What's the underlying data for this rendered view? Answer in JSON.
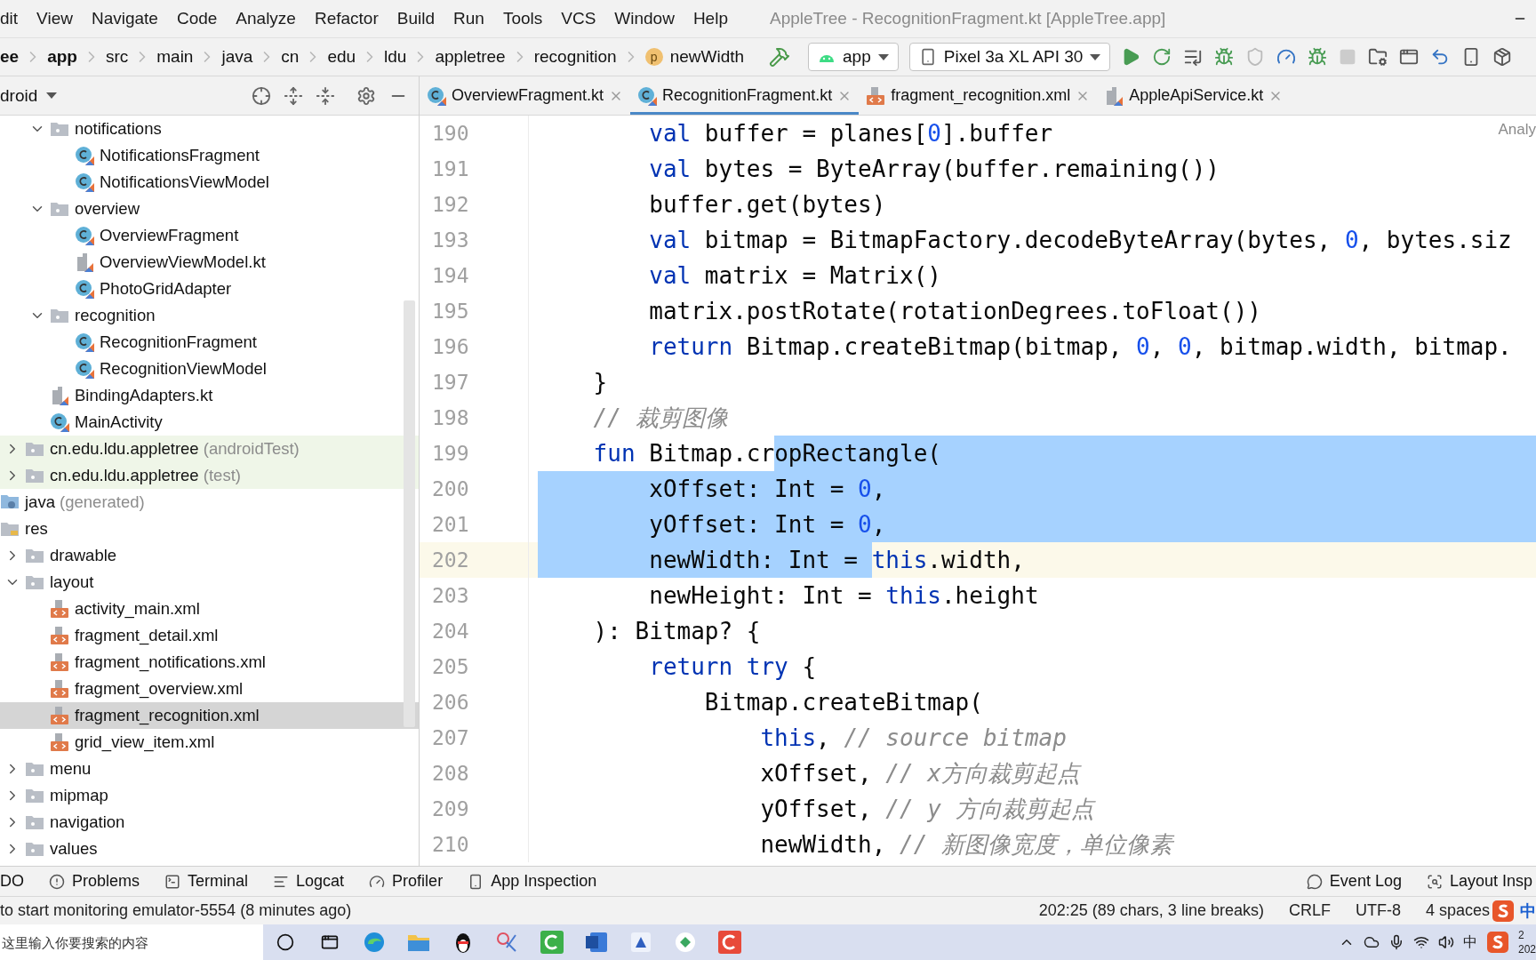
{
  "menu_bar": {
    "items": [
      "dit",
      "View",
      "Navigate",
      "Code",
      "Analyze",
      "Refactor",
      "Build",
      "Run",
      "Tools",
      "VCS",
      "Window",
      "Help"
    ],
    "title": "AppleTree - RecognitionFragment.kt [AppleTree.app]"
  },
  "breadcrumb": [
    {
      "label": "ee",
      "bold": true,
      "kind": "path"
    },
    {
      "label": "app",
      "bold": true,
      "kind": "path"
    },
    {
      "label": "src",
      "bold": false,
      "kind": "path"
    },
    {
      "label": "main",
      "bold": false,
      "kind": "path"
    },
    {
      "label": "java",
      "bold": false,
      "kind": "path"
    },
    {
      "label": "cn",
      "bold": false,
      "kind": "path"
    },
    {
      "label": "edu",
      "bold": false,
      "kind": "path"
    },
    {
      "label": "ldu",
      "bold": false,
      "kind": "path"
    },
    {
      "label": "appletree",
      "bold": false,
      "kind": "path"
    },
    {
      "label": "recognition",
      "bold": false,
      "kind": "path"
    },
    {
      "label": "newWidth",
      "bold": false,
      "kind": "property",
      "badge": "p"
    }
  ],
  "toolbar": {
    "config": "app",
    "device": "Pixel 3a XL API 30"
  },
  "project_panel": {
    "view": "droid",
    "tree": [
      {
        "kind": "continuation",
        "children": [
          {
            "kind": "continuation",
            "children": [
              {
                "label": "notifications",
                "kind": "folder",
                "expanded": true,
                "selected": false,
                "children": [
                  {
                    "label": "NotificationsFragment",
                    "kind": "kotlin-class",
                    "selected": false
                  },
                  {
                    "label": "NotificationsViewModel",
                    "kind": "kotlin-class",
                    "selected": false
                  }
                ]
              },
              {
                "label": "overview",
                "kind": "folder",
                "expanded": true,
                "selected": false,
                "children": [
                  {
                    "label": "OverviewFragment",
                    "kind": "kotlin-class",
                    "selected": false
                  },
                  {
                    "label": "OverviewViewModel.kt",
                    "kind": "kotlin-file",
                    "selected": false
                  },
                  {
                    "label": "PhotoGridAdapter",
                    "kind": "kotlin-class",
                    "selected": false
                  }
                ]
              },
              {
                "label": "recognition",
                "kind": "folder",
                "expanded": true,
                "selected": false,
                "children": [
                  {
                    "label": "RecognitionFragment",
                    "kind": "kotlin-class",
                    "selected": false
                  },
                  {
                    "label": "RecognitionViewModel",
                    "kind": "kotlin-class",
                    "selected": false
                  }
                ]
              },
              {
                "label": "BindingAdapters.kt",
                "kind": "kotlin-file",
                "selected": false
              },
              {
                "label": "MainActivity",
                "kind": "kotlin-class",
                "selected": false
              }
            ]
          },
          {
            "label": "cn.edu.ldu.appletree",
            "suffix": "(androidTest)",
            "kind": "folder",
            "expanded": false,
            "tinted": true,
            "selected": false
          },
          {
            "label": "cn.edu.ldu.appletree",
            "suffix": "(test)",
            "kind": "folder",
            "expanded": false,
            "tinted": true,
            "selected": false
          }
        ]
      },
      {
        "label": "java",
        "suffix": "(generated)",
        "kind": "generated-folder",
        "selected": false
      },
      {
        "label": "res",
        "kind": "res-folder",
        "selected": false,
        "children": [
          {
            "label": "drawable",
            "kind": "folder",
            "expanded": false,
            "selected": false
          },
          {
            "label": "layout",
            "kind": "folder",
            "expanded": true,
            "selected": false,
            "children": [
              {
                "label": "activity_main.xml",
                "kind": "xml",
                "selected": false
              },
              {
                "label": "fragment_detail.xml",
                "kind": "xml",
                "selected": false
              },
              {
                "label": "fragment_notifications.xml",
                "kind": "xml",
                "selected": false
              },
              {
                "label": "fragment_overview.xml",
                "kind": "xml",
                "selected": false
              },
              {
                "label": "fragment_recognition.xml",
                "kind": "xml",
                "selected": true
              },
              {
                "label": "grid_view_item.xml",
                "kind": "xml",
                "selected": false
              }
            ]
          },
          {
            "label": "menu",
            "kind": "folder",
            "expanded": false,
            "selected": false
          },
          {
            "label": "mipmap",
            "kind": "folder",
            "expanded": false,
            "selected": false
          },
          {
            "label": "navigation",
            "kind": "folder",
            "expanded": false,
            "selected": false
          },
          {
            "label": "values",
            "kind": "folder",
            "expanded": false,
            "selected": false
          }
        ]
      }
    ]
  },
  "editor": {
    "tabs": [
      {
        "label": "OverviewFragment.kt",
        "kind": "kotlin-class",
        "selected": false
      },
      {
        "label": "RecognitionFragment.kt",
        "kind": "kotlin-class",
        "selected": true
      },
      {
        "label": "fragment_recognition.xml",
        "kind": "xml",
        "selected": false
      },
      {
        "label": "AppleApiService.kt",
        "kind": "kotlin-file",
        "selected": false
      }
    ],
    "inspection": "Analy",
    "lines": [
      {
        "number": "190",
        "current": false,
        "selected_to_end": false,
        "tokens": [
          {
            "text": "        val",
            "kind": "keyword",
            "selected": false
          },
          {
            "text": " buffer = planes[",
            "kind": "plain",
            "selected": false
          },
          {
            "text": "0",
            "kind": "number",
            "selected": false
          },
          {
            "text": "].buffer",
            "kind": "plain",
            "selected": false
          }
        ]
      },
      {
        "number": "191",
        "current": false,
        "selected_to_end": false,
        "tokens": [
          {
            "text": "        val",
            "kind": "keyword",
            "selected": false
          },
          {
            "text": " bytes = ByteArray(buffer.remaining())",
            "kind": "plain",
            "selected": false
          }
        ]
      },
      {
        "number": "192",
        "current": false,
        "selected_to_end": false,
        "tokens": [
          {
            "text": "        buffer.get(bytes)",
            "kind": "plain",
            "selected": false
          }
        ]
      },
      {
        "number": "193",
        "current": false,
        "selected_to_end": false,
        "tokens": [
          {
            "text": "        val",
            "kind": "keyword",
            "selected": false
          },
          {
            "text": " bitmap = BitmapFactory.decodeByteArray(bytes, ",
            "kind": "plain",
            "selected": false
          },
          {
            "text": "0",
            "kind": "number",
            "selected": false
          },
          {
            "text": ", bytes.siz",
            "kind": "plain",
            "selected": false
          }
        ]
      },
      {
        "number": "194",
        "current": false,
        "selected_to_end": false,
        "tokens": [
          {
            "text": "        val",
            "kind": "keyword",
            "selected": false
          },
          {
            "text": " matrix = Matrix()",
            "kind": "plain",
            "selected": false
          }
        ]
      },
      {
        "number": "195",
        "current": false,
        "selected_to_end": false,
        "tokens": [
          {
            "text": "        matrix.postRotate(rotationDegrees.toFloat())",
            "kind": "plain",
            "selected": false
          }
        ]
      },
      {
        "number": "196",
        "current": false,
        "selected_to_end": false,
        "tokens": [
          {
            "text": "        return",
            "kind": "keyword",
            "selected": false
          },
          {
            "text": " Bitmap.createBitmap(bitmap, ",
            "kind": "plain",
            "selected": false
          },
          {
            "text": "0",
            "kind": "number",
            "selected": false
          },
          {
            "text": ", ",
            "kind": "plain",
            "selected": false
          },
          {
            "text": "0",
            "kind": "number",
            "selected": false
          },
          {
            "text": ", bitmap.width, bitmap.",
            "kind": "plain",
            "selected": false
          }
        ]
      },
      {
        "number": "197",
        "current": false,
        "selected_to_end": false,
        "tokens": [
          {
            "text": "    }",
            "kind": "plain",
            "selected": false
          }
        ]
      },
      {
        "number": "198",
        "current": false,
        "selected_to_end": false,
        "tokens": [
          {
            "text": "    // 裁剪图像",
            "kind": "comment",
            "selected": false
          }
        ]
      },
      {
        "number": "199",
        "current": false,
        "selected_to_end": true,
        "tokens": [
          {
            "text": "    fun",
            "kind": "keyword",
            "selected": false
          },
          {
            "text": " Bitmap.cr",
            "kind": "plain",
            "selected": false
          },
          {
            "text": "opRectangle(",
            "kind": "plain",
            "selected": true
          }
        ]
      },
      {
        "number": "200",
        "current": false,
        "selected_to_end": true,
        "tokens": [
          {
            "text": "        xOffset: Int = ",
            "kind": "plain",
            "selected": true
          },
          {
            "text": "0",
            "kind": "number",
            "selected": true
          },
          {
            "text": ",",
            "kind": "plain",
            "selected": true
          }
        ]
      },
      {
        "number": "201",
        "current": false,
        "selected_to_end": true,
        "tokens": [
          {
            "text": "        yOffset: Int = ",
            "kind": "plain",
            "selected": true
          },
          {
            "text": "0",
            "kind": "number",
            "selected": true
          },
          {
            "text": ",",
            "kind": "plain",
            "selected": true
          }
        ]
      },
      {
        "number": "202",
        "current": true,
        "selected_to_end": false,
        "tokens": [
          {
            "text": "        newWidth: Int = ",
            "kind": "plain",
            "selected": true
          },
          {
            "text": "this",
            "kind": "keyword",
            "selected": false
          },
          {
            "text": ".width,",
            "kind": "plain",
            "selected": false
          }
        ]
      },
      {
        "number": "203",
        "current": false,
        "selected_to_end": false,
        "tokens": [
          {
            "text": "        newHeight: Int = ",
            "kind": "plain",
            "selected": false
          },
          {
            "text": "this",
            "kind": "keyword",
            "selected": false
          },
          {
            "text": ".height",
            "kind": "plain",
            "selected": false
          }
        ]
      },
      {
        "number": "204",
        "current": false,
        "selected_to_end": false,
        "tokens": [
          {
            "text": "    ): Bitmap? {",
            "kind": "plain",
            "selected": false
          }
        ]
      },
      {
        "number": "205",
        "current": false,
        "selected_to_end": false,
        "tokens": [
          {
            "text": "        return try",
            "kind": "keyword",
            "selected": false
          },
          {
            "text": " {",
            "kind": "plain",
            "selected": false
          }
        ]
      },
      {
        "number": "206",
        "current": false,
        "selected_to_end": false,
        "tokens": [
          {
            "text": "            Bitmap.createBitmap(",
            "kind": "plain",
            "selected": false
          }
        ]
      },
      {
        "number": "207",
        "current": false,
        "selected_to_end": false,
        "tokens": [
          {
            "text": "                this",
            "kind": "keyword",
            "selected": false
          },
          {
            "text": ", ",
            "kind": "plain",
            "selected": false
          },
          {
            "text": "// source bitmap",
            "kind": "comment",
            "selected": false
          }
        ]
      },
      {
        "number": "208",
        "current": false,
        "selected_to_end": false,
        "tokens": [
          {
            "text": "                xOffset, ",
            "kind": "plain",
            "selected": false
          },
          {
            "text": "// x方向裁剪起点",
            "kind": "comment",
            "selected": false
          }
        ]
      },
      {
        "number": "209",
        "current": false,
        "selected_to_end": false,
        "tokens": [
          {
            "text": "                yOffset, ",
            "kind": "plain",
            "selected": false
          },
          {
            "text": "// y 方向裁剪起点",
            "kind": "comment",
            "selected": false
          }
        ]
      },
      {
        "number": "210",
        "current": false,
        "selected_to_end": false,
        "tokens": [
          {
            "text": "                newWidth, ",
            "kind": "plain",
            "selected": false
          },
          {
            "text": "// 新图像宽度，单位像素",
            "kind": "comment",
            "selected": false
          }
        ]
      }
    ]
  },
  "tool_windows": {
    "left": [
      {
        "label": "DO",
        "kind": "none"
      },
      {
        "label": "Problems",
        "kind": "problems"
      },
      {
        "label": "Terminal",
        "kind": "terminal"
      },
      {
        "label": "Logcat",
        "kind": "logcat"
      },
      {
        "label": "Profiler",
        "kind": "profiler"
      },
      {
        "label": "App Inspection",
        "kind": "inspection"
      }
    ],
    "right": [
      {
        "label": "Event Log",
        "kind": "event-log"
      },
      {
        "label": "Layout Insp",
        "kind": "layout-inspector"
      }
    ]
  },
  "status_bar": {
    "message": "to start monitoring emulator-5554 (8 minutes ago)",
    "items": [
      "202:25 (89 chars, 3 line breaks)",
      "CRLF",
      "UTF-8",
      "4 spaces"
    ],
    "ime": "中"
  },
  "taskbar": {
    "search_placeholder": "这里输入你要搜索的内容",
    "tray_ime": "中",
    "clock": [
      "2",
      "202"
    ]
  }
}
